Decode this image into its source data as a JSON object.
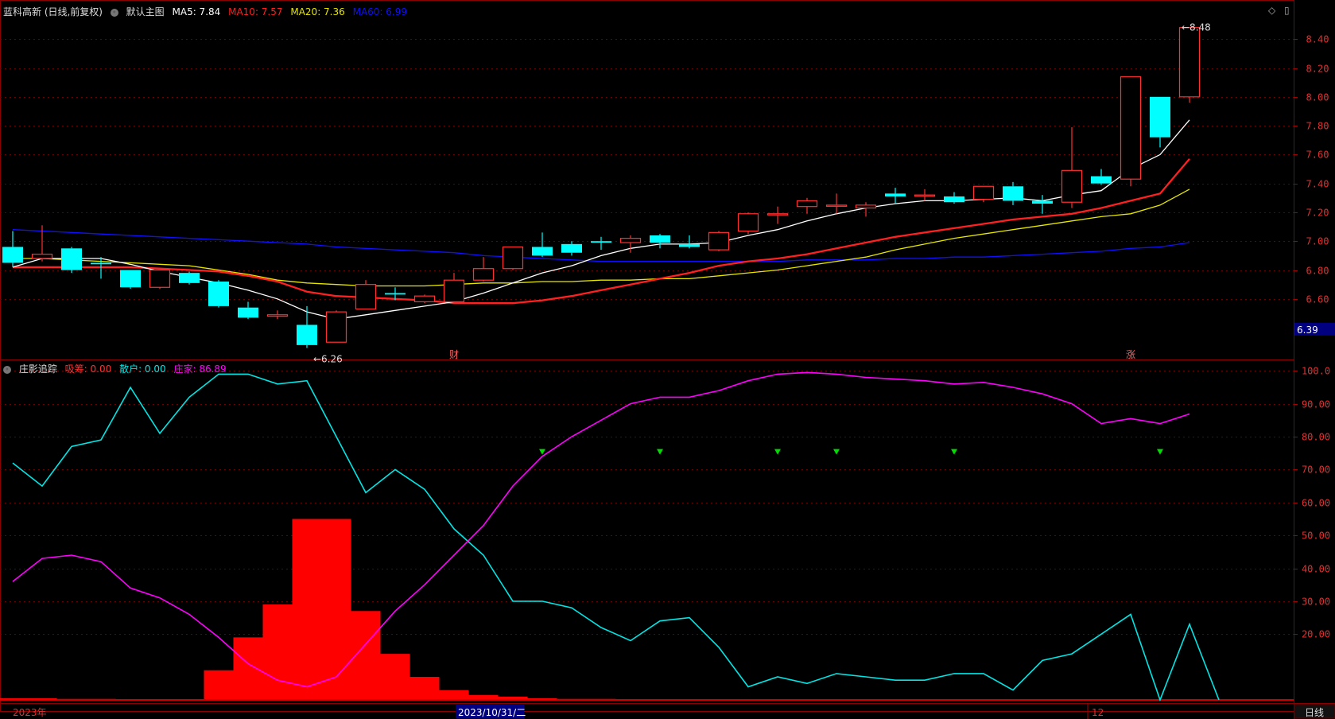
{
  "header": {
    "stock_title": "蓝科高新 (日线,前复权)",
    "main_chart_label": "默认主图",
    "ma5": "MA5: 7.84",
    "ma10": "MA10: 7.57",
    "ma20": "MA20: 7.36",
    "ma60": "MA60: 6.99"
  },
  "indicator_header": {
    "name": "庄影追踪",
    "xichou": "吸筹: 0.00",
    "sanhu": "散户: 0.00",
    "zhuangjia": "庄家: 86.89"
  },
  "colors": {
    "up": "#ff3030",
    "down": "#00ffff",
    "ma5": "#ffffff",
    "ma10": "#ff2020",
    "ma20": "#e6e600",
    "ma60": "#1010ff",
    "sanhu": "#00e5e5",
    "zhuangjia": "#ff00ff",
    "xichou": "#ff0000",
    "signal": "#00dd00"
  },
  "chart_data": [
    {
      "type": "candlestick",
      "ylim": [
        6.18,
        8.55
      ],
      "y_ticks": [
        "8.40",
        "8.20",
        "8.00",
        "7.80",
        "7.60",
        "7.40",
        "7.20",
        "7.00",
        "6.80",
        "6.60"
      ],
      "max_annotation": "8.48",
      "min_annotation": "6.26",
      "current_price_tag": "6.39",
      "event_markers": [
        {
          "index": 15,
          "text": "财"
        },
        {
          "index": 38,
          "text": "涨"
        }
      ],
      "candles": [
        [
          6.96,
          7.07,
          6.82,
          6.85
        ],
        [
          6.88,
          7.11,
          6.86,
          6.91
        ],
        [
          6.95,
          6.96,
          6.78,
          6.8
        ],
        [
          6.85,
          6.89,
          6.74,
          6.84
        ],
        [
          6.8,
          6.8,
          6.67,
          6.68
        ],
        [
          6.68,
          6.8,
          6.67,
          6.8
        ],
        [
          6.78,
          6.79,
          6.7,
          6.71
        ],
        [
          6.72,
          6.73,
          6.54,
          6.55
        ],
        [
          6.54,
          6.58,
          6.46,
          6.47
        ],
        [
          6.48,
          6.52,
          6.46,
          6.49
        ],
        [
          6.42,
          6.55,
          6.26,
          6.28
        ],
        [
          6.3,
          6.52,
          6.3,
          6.51
        ],
        [
          6.53,
          6.73,
          6.53,
          6.7
        ],
        [
          6.64,
          6.68,
          6.59,
          6.63
        ],
        [
          6.58,
          6.63,
          6.57,
          6.62
        ],
        [
          6.58,
          6.78,
          6.57,
          6.73
        ],
        [
          6.73,
          6.89,
          6.72,
          6.81
        ],
        [
          6.81,
          6.96,
          6.8,
          6.96
        ],
        [
          6.96,
          7.06,
          6.89,
          6.9
        ],
        [
          6.98,
          7.0,
          6.9,
          6.92
        ],
        [
          7.0,
          7.03,
          6.94,
          6.99
        ],
        [
          6.99,
          7.04,
          6.92,
          7.02
        ],
        [
          7.04,
          7.05,
          6.95,
          6.99
        ],
        [
          6.98,
          7.04,
          6.95,
          6.96
        ],
        [
          6.94,
          7.07,
          6.93,
          7.06
        ],
        [
          7.07,
          7.2,
          7.05,
          7.19
        ],
        [
          7.19,
          7.24,
          7.12,
          7.19
        ],
        [
          7.24,
          7.3,
          7.19,
          7.28
        ],
        [
          7.25,
          7.33,
          7.19,
          7.25
        ],
        [
          7.23,
          7.27,
          7.17,
          7.25
        ],
        [
          7.33,
          7.37,
          7.26,
          7.31
        ],
        [
          7.32,
          7.36,
          7.28,
          7.32
        ],
        [
          7.31,
          7.34,
          7.26,
          7.27
        ],
        [
          7.29,
          7.37,
          7.27,
          7.38
        ],
        [
          7.38,
          7.41,
          7.25,
          7.28
        ],
        [
          7.28,
          7.32,
          7.19,
          7.26
        ],
        [
          7.27,
          7.79,
          7.23,
          7.49
        ],
        [
          7.45,
          7.5,
          7.39,
          7.4
        ],
        [
          7.43,
          8.14,
          7.38,
          8.14
        ],
        [
          8.0,
          8.0,
          7.65,
          7.72
        ],
        [
          8.0,
          8.48,
          7.96,
          8.48
        ]
      ],
      "ma5": [
        6.82,
        6.88,
        6.88,
        6.88,
        6.84,
        6.79,
        6.75,
        6.71,
        6.66,
        6.6,
        6.51,
        6.46,
        6.49,
        6.52,
        6.55,
        6.58,
        6.64,
        6.71,
        6.78,
        6.83,
        6.9,
        6.95,
        6.98,
        6.98,
        6.99,
        7.04,
        7.08,
        7.14,
        7.19,
        7.23,
        7.26,
        7.28,
        7.28,
        7.29,
        7.3,
        7.28,
        7.32,
        7.35,
        7.5,
        7.6,
        7.84
      ],
      "ma10": [
        6.82,
        6.82,
        6.82,
        6.82,
        6.82,
        6.81,
        6.8,
        6.79,
        6.76,
        6.72,
        6.65,
        6.62,
        6.61,
        6.6,
        6.59,
        6.57,
        6.57,
        6.57,
        6.59,
        6.62,
        6.66,
        6.7,
        6.74,
        6.78,
        6.83,
        6.86,
        6.88,
        6.91,
        6.95,
        6.99,
        7.03,
        7.06,
        7.09,
        7.12,
        7.15,
        7.17,
        7.19,
        7.23,
        7.28,
        7.33,
        7.57
      ],
      "ma20": [
        6.88,
        6.88,
        6.87,
        6.86,
        6.85,
        6.84,
        6.83,
        6.8,
        6.77,
        6.73,
        6.71,
        6.7,
        6.69,
        6.69,
        6.69,
        6.7,
        6.71,
        6.71,
        6.72,
        6.72,
        6.73,
        6.73,
        6.74,
        6.74,
        6.76,
        6.78,
        6.8,
        6.83,
        6.86,
        6.89,
        6.94,
        6.98,
        7.02,
        7.05,
        7.08,
        7.11,
        7.14,
        7.17,
        7.19,
        7.25,
        7.36
      ],
      "ma60": [
        7.08,
        7.07,
        7.06,
        7.05,
        7.04,
        7.03,
        7.02,
        7.01,
        7.0,
        6.99,
        6.98,
        6.96,
        6.95,
        6.94,
        6.93,
        6.92,
        6.9,
        6.89,
        6.88,
        6.87,
        6.86,
        6.86,
        6.86,
        6.86,
        6.86,
        6.86,
        6.86,
        6.87,
        6.87,
        6.87,
        6.88,
        6.88,
        6.89,
        6.89,
        6.9,
        6.91,
        6.92,
        6.93,
        6.95,
        6.96,
        6.99
      ]
    },
    {
      "type": "line",
      "title": "庄影追踪",
      "ylim": [
        0,
        102
      ],
      "y_ticks": [
        "100.0",
        "90.00",
        "80.00",
        "70.00",
        "60.00",
        "50.00",
        "40.00",
        "30.00",
        "20.00"
      ],
      "series": [
        {
          "name": "散户",
          "values": [
            72,
            65,
            77,
            79,
            95,
            81,
            92,
            99,
            99,
            96,
            97,
            80,
            63,
            70,
            64,
            52,
            44,
            30,
            30,
            28,
            22,
            18,
            24,
            25,
            16,
            4,
            7,
            5,
            8,
            7,
            6,
            6,
            8,
            8,
            3,
            12,
            14,
            20,
            26,
            0,
            23,
            0
          ]
        },
        {
          "name": "庄家",
          "values": [
            36,
            43,
            44,
            42,
            34,
            31,
            26,
            19,
            11,
            6,
            4,
            7,
            17,
            27,
            35,
            44,
            53,
            65,
            74,
            80,
            85,
            90,
            92,
            92,
            94,
            97,
            99,
            99.5,
            99,
            98,
            97.5,
            97,
            96,
            96.5,
            95,
            93,
            90,
            84,
            85.5,
            84,
            86.9
          ]
        },
        {
          "name": "吸筹",
          "type": "bar",
          "values": [
            0.5,
            0.5,
            0.3,
            0.3,
            0.2,
            0.2,
            0.2,
            9,
            19,
            29,
            55,
            55,
            27,
            14,
            7,
            3,
            1.5,
            1,
            0.5,
            0.3,
            0.3,
            0.2,
            0.2,
            0.1,
            0.1,
            0.1,
            0.1,
            0.1,
            0.1,
            0.1,
            0.1,
            0.1,
            0.1,
            0.1,
            0.1,
            0.1,
            0.1,
            0.1,
            0.1,
            0.1,
            0.1,
            0.1
          ]
        }
      ],
      "signals_at": [
        18,
        22,
        26,
        28,
        32,
        39
      ]
    }
  ],
  "xaxis": {
    "year_label": "2023年",
    "cursor_date": "2023/10/31/二",
    "month_label": "12"
  },
  "period_button": "日线"
}
